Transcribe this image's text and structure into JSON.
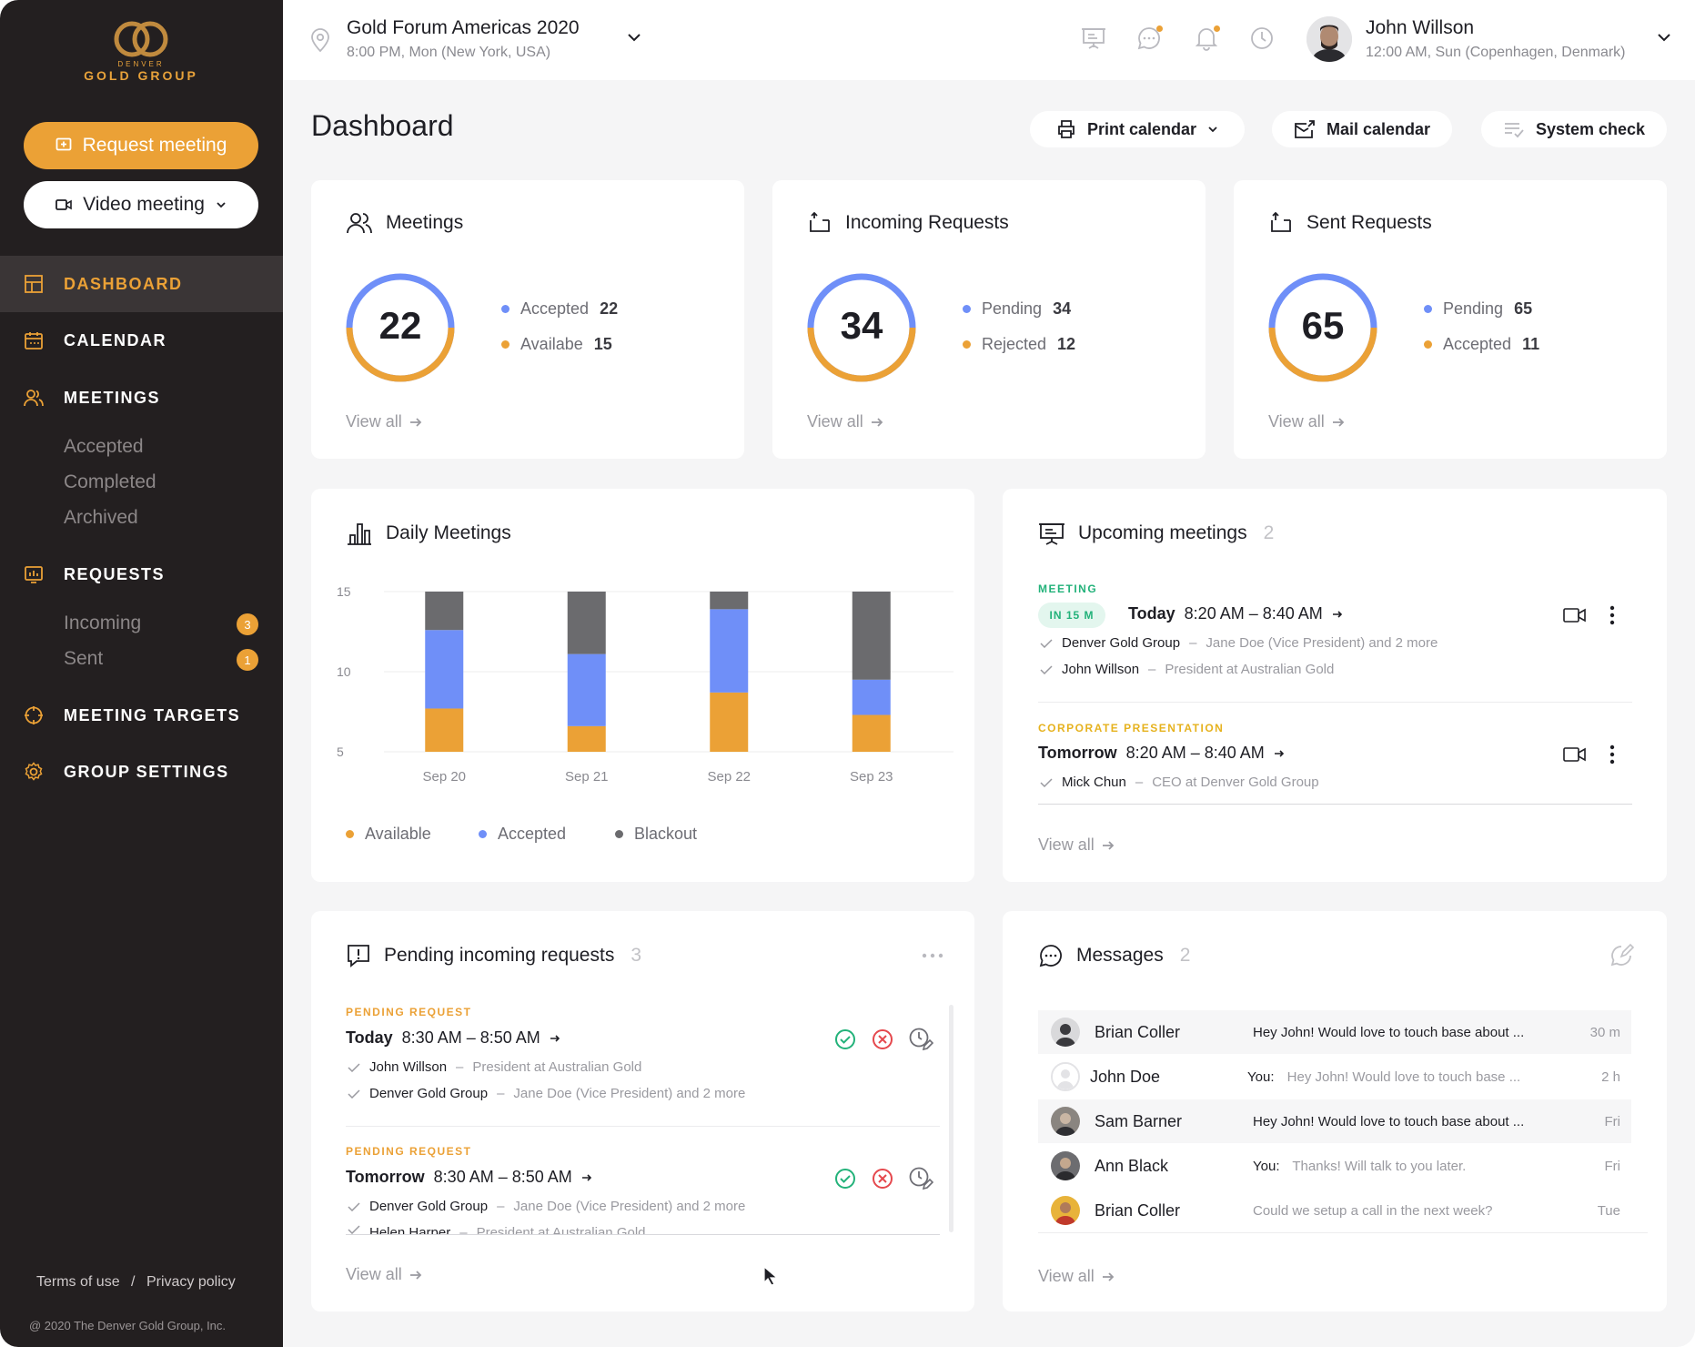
{
  "brand": {
    "line1": "DENVER",
    "line2": "GOLD GROUP",
    "accent": "#eba136",
    "sidebar_bg": "#231f20"
  },
  "sidebar": {
    "request_button": "Request meeting",
    "video_button": "Video meeting",
    "nav": [
      {
        "label": "DASHBOARD",
        "icon": "dashboard-grid-icon"
      },
      {
        "label": "CALENDAR",
        "icon": "calendar-icon"
      },
      {
        "label": "MEETINGS",
        "icon": "people-icon"
      },
      {
        "label": "REQUESTS",
        "icon": "requests-icon"
      },
      {
        "label": "MEETING TARGETS",
        "icon": "target-icon"
      },
      {
        "label": "GROUP SETTINGS",
        "icon": "gear-icon"
      }
    ],
    "meetings_sub": [
      "Accepted",
      "Completed",
      "Archived"
    ],
    "requests_sub": [
      {
        "label": "Incoming",
        "badge": "3"
      },
      {
        "label": "Sent",
        "badge": "1"
      }
    ],
    "footer_links": {
      "terms": "Terms of use",
      "sep": "/",
      "privacy": "Privacy policy"
    },
    "copyright": "@ 2020 The Denver Gold Group, Inc."
  },
  "topbar": {
    "event_name": "Gold Forum Americas 2020",
    "event_time": "8:00 PM, Mon (New York, USA)",
    "user_name": "John Willson",
    "user_time": "12:00 AM, Sun (Copenhagen, Denmark)"
  },
  "page": {
    "title": "Dashboard",
    "print_calendar": "Print calendar",
    "mail_calendar": "Mail calendar",
    "system_check": "System check"
  },
  "stats": [
    {
      "title": "Meetings",
      "total": "22",
      "rows": [
        {
          "label": "Accepted",
          "value": "22"
        },
        {
          "label": "Availabe",
          "value": "15"
        }
      ],
      "view_all": "View all"
    },
    {
      "title": "Incoming Requests",
      "total": "34",
      "rows": [
        {
          "label": "Pending",
          "value": "34"
        },
        {
          "label": "Rejected",
          "value": "12"
        }
      ],
      "view_all": "View all"
    },
    {
      "title": "Sent Requests",
      "total": "65",
      "rows": [
        {
          "label": "Pending",
          "value": "65"
        },
        {
          "label": "Accepted",
          "value": "11"
        }
      ],
      "view_all": "View all"
    }
  ],
  "daily": {
    "title": "Daily Meetings"
  },
  "chart_data": {
    "type": "bar",
    "stacked": true,
    "categories": [
      "Sep 20",
      "Sep 21",
      "Sep 22",
      "Sep 23"
    ],
    "series": [
      {
        "name": "Available",
        "color": "#eba136",
        "values": [
          2.7,
          1.6,
          3.7,
          2.3
        ]
      },
      {
        "name": "Accepted",
        "color": "#6f8ff8",
        "values": [
          4.9,
          4.5,
          5.2,
          2.2
        ]
      },
      {
        "name": "Blackout",
        "color": "#6b6b6e",
        "values": [
          2.4,
          3.9,
          1.1,
          5.5
        ]
      }
    ],
    "yticks": [
      "15",
      "10",
      "5"
    ],
    "ylim": [
      5,
      15
    ],
    "grid": true,
    "legend": "bottom-left"
  },
  "upcoming": {
    "title": "Upcoming meetings",
    "count": "2",
    "items": [
      {
        "tag": "MEETING",
        "pill": "IN 15 M",
        "day": "Today",
        "time": "8:20 AM – 8:40 AM",
        "attendees": [
          {
            "name": "Denver Gold Group",
            "sep": "–",
            "role": "Jane Doe (Vice President) and 2 more"
          },
          {
            "name": "John Willson",
            "sep": "–",
            "role": "President at Australian Gold"
          }
        ]
      },
      {
        "tag": "CORPORATE PRESENTATION",
        "day": "Tomorrow",
        "time": "8:20 AM – 8:40 AM",
        "attendees": [
          {
            "name": "Mick Chun",
            "sep": "–",
            "role": "CEO at Denver Gold Group"
          }
        ]
      }
    ],
    "view_all": "View all"
  },
  "pending": {
    "title": "Pending incoming requests",
    "count": "3",
    "items": [
      {
        "tag": "PENDING REQUEST",
        "day": "Today",
        "time": "8:30 AM – 8:50 AM",
        "attendees": [
          {
            "name": "John Willson",
            "sep": "–",
            "role": "President at Australian Gold"
          },
          {
            "name": "Denver Gold Group",
            "sep": "–",
            "role": "Jane Doe (Vice President) and 2 more"
          }
        ]
      },
      {
        "tag": "PENDING REQUEST",
        "day": "Tomorrow",
        "time": "8:30 AM – 8:50 AM",
        "attendees": [
          {
            "name": "Denver Gold Group",
            "sep": "–",
            "role": "Jane Doe (Vice President) and 2 more"
          },
          {
            "name": "Helen Harper",
            "sep": "–",
            "role": "President at Australian Gold"
          }
        ]
      }
    ],
    "view_all": "View all"
  },
  "messages": {
    "title": "Messages",
    "count": "2",
    "items": [
      {
        "name": "Brian Coller",
        "you": "",
        "text": "Hey John! Would love to touch base about ...",
        "time": "30 m",
        "unread": true
      },
      {
        "name": "John Doe",
        "you": "You:",
        "text": "Hey John! Would love to touch base ...",
        "time": "2 h",
        "unread": false
      },
      {
        "name": "Sam Barner",
        "you": "",
        "text": "Hey John! Would love to touch base about ...",
        "time": "Fri",
        "unread": true
      },
      {
        "name": "Ann Black",
        "you": "You:",
        "text": "Thanks! Will talk to you later.",
        "time": "Fri",
        "unread": false
      },
      {
        "name": "Brian Coller",
        "you": "",
        "text": "Could we setup a call in the next week?",
        "time": "Tue",
        "unread": false
      }
    ],
    "view_all": "View all"
  }
}
